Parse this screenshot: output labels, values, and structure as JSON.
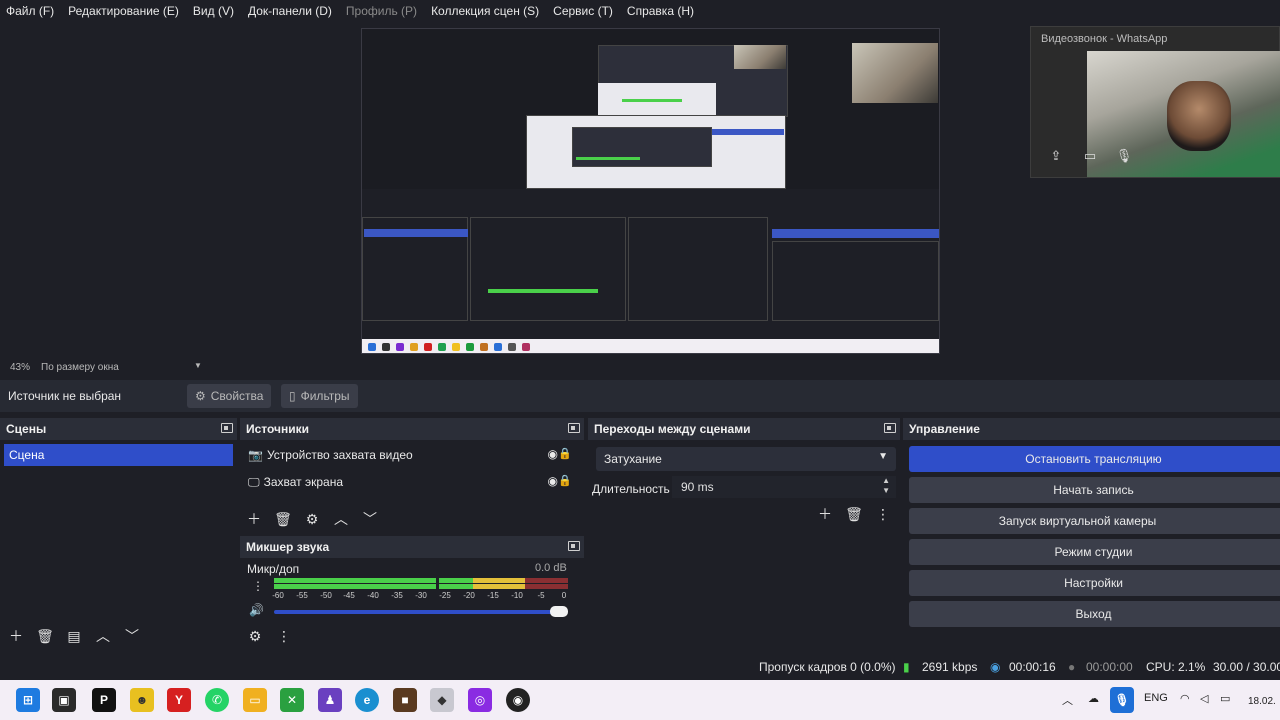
{
  "menu": {
    "items": [
      "Файл (F)",
      "Редактирование (E)",
      "Вид (V)",
      "Док-панели (D)",
      "Профиль (P)",
      "Коллекция сцен (S)",
      "Сервис (T)",
      "Справка (H)"
    ]
  },
  "whatsapp": {
    "title": "Видеозвонок - WhatsApp"
  },
  "zoom": {
    "percent": "43%",
    "mode": "По размеру окна"
  },
  "context": {
    "label": "Источник не выбран",
    "properties": "Свойства",
    "filters": "Фильтры"
  },
  "scenes": {
    "title": "Сцены",
    "items": [
      "Сцена"
    ]
  },
  "sources": {
    "title": "Источники",
    "items": [
      "Устройство захвата видео",
      "Захват экрана"
    ]
  },
  "transitions": {
    "title": "Переходы между сценами",
    "selected": "Затухание",
    "duration_label": "Длительность",
    "duration_value": "90 ms"
  },
  "controls": {
    "title": "Управление",
    "buttons": [
      "Остановить трансляцию",
      "Начать запись",
      "Запуск виртуальной камеры",
      "Режим студии",
      "Настройки",
      "Выход"
    ]
  },
  "mixer": {
    "title": "Микшер звука",
    "channel": "Микр/доп",
    "db": "0.0 dB",
    "scale": [
      "-60",
      "-55",
      "-50",
      "-45",
      "-40",
      "-35",
      "-30",
      "-25",
      "-20",
      "-15",
      "-10",
      "-5",
      "0"
    ]
  },
  "status": {
    "dropped": "Пропуск кадров 0 (0.0%)",
    "bitrate": "2691 kbps",
    "stream_time": "00:00:16",
    "rec_time": "00:00:00",
    "cpu": "CPU: 2.1%",
    "fps": "30.00 / 30.00"
  },
  "taskbar": {
    "lang": "ENG",
    "date": "18.02."
  },
  "colors": {
    "accent": "#2f4ec9",
    "bg": "#1e1f26",
    "panel": "#272a33",
    "meter_green": "#4ad04a",
    "meter_yellow": "#e4c03a",
    "meter_red": "#d23a3a"
  }
}
